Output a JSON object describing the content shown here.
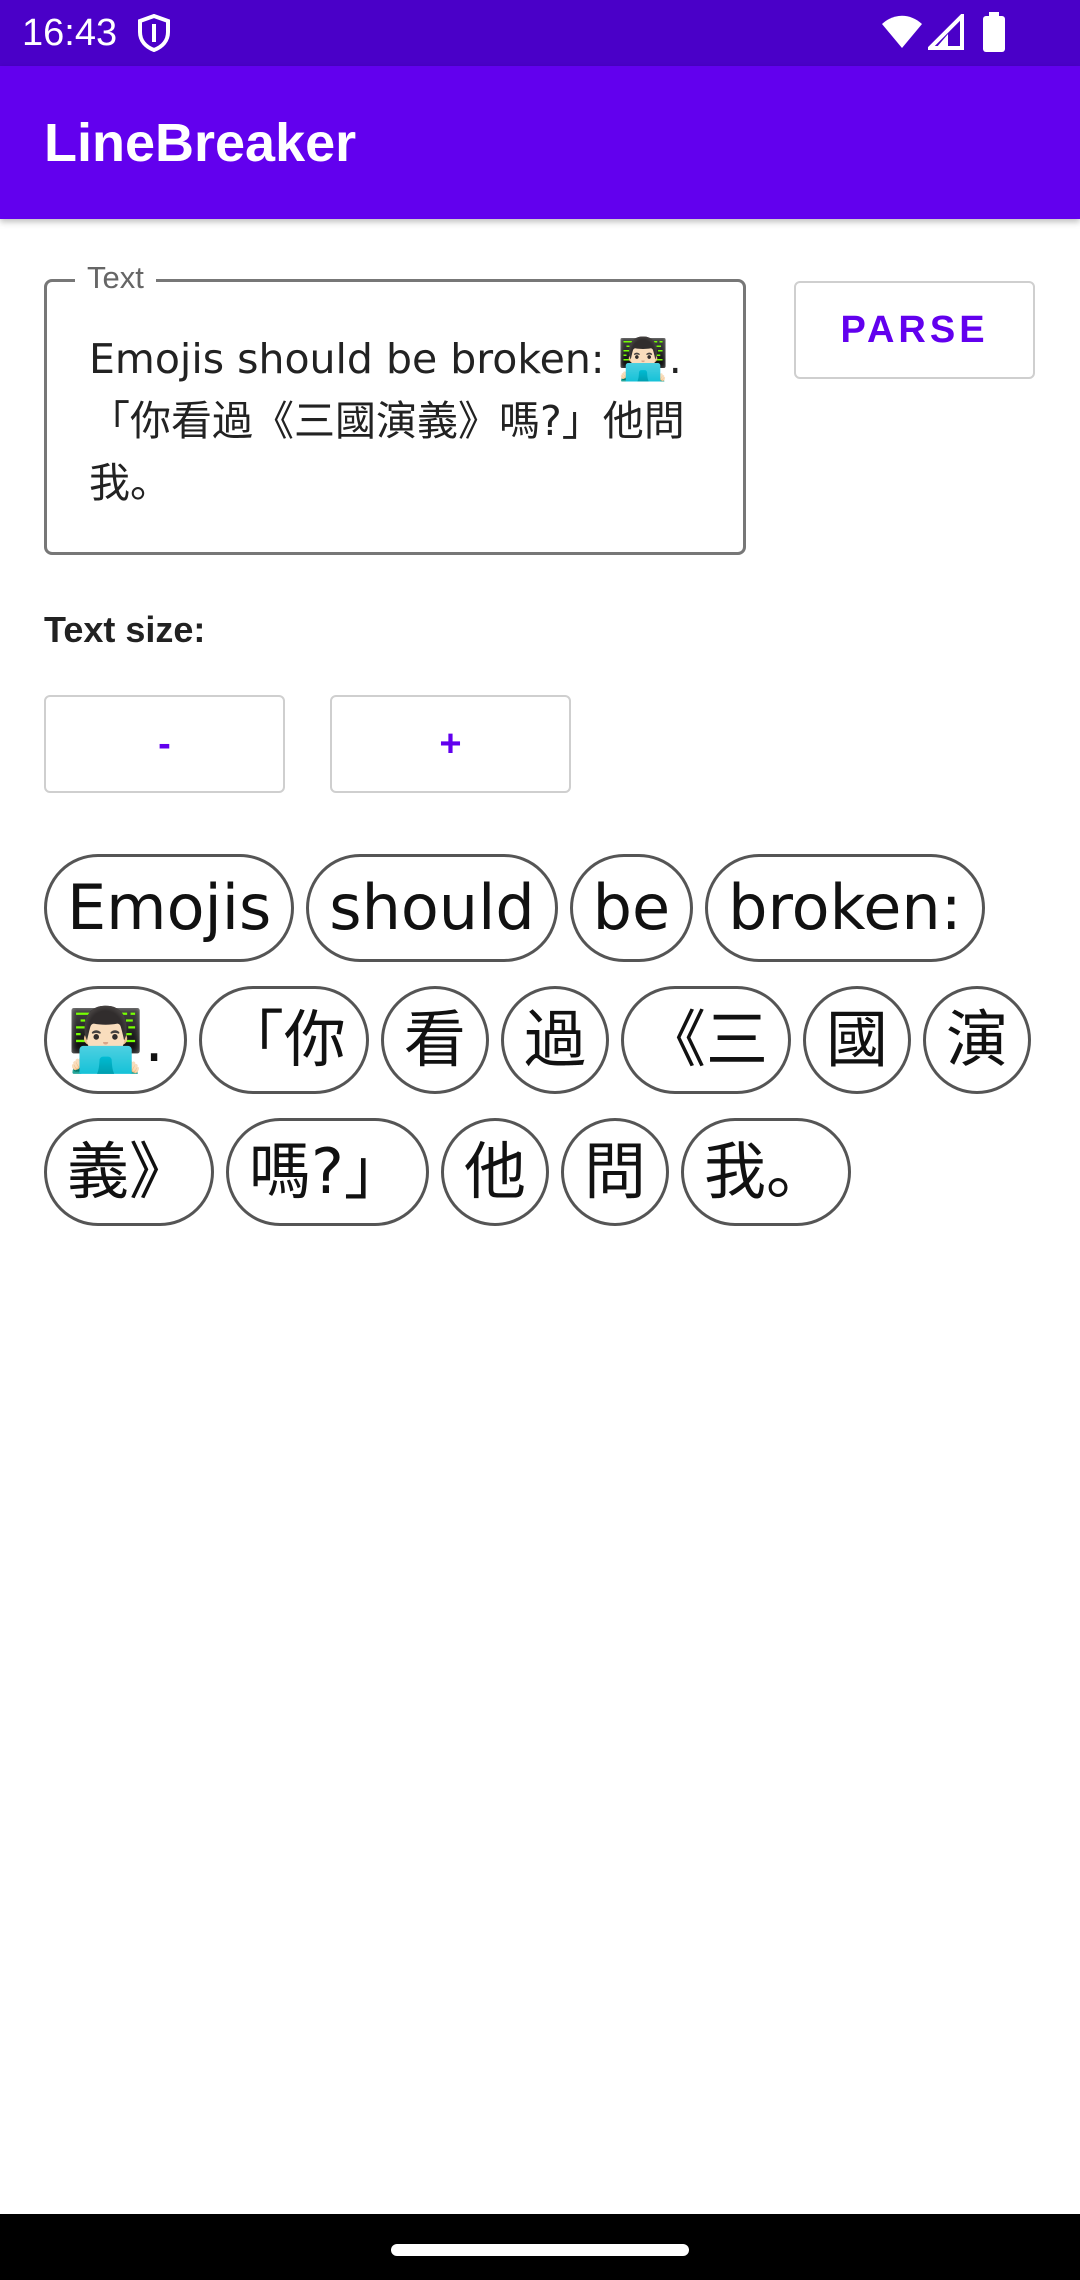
{
  "status_bar": {
    "time": "16:43",
    "icons": [
      "shield-icon",
      "wifi-icon",
      "signal-icon",
      "battery-icon"
    ]
  },
  "app_bar": {
    "title": "LineBreaker",
    "color": "#6200ee"
  },
  "text_field": {
    "label": "Text",
    "value": "Emojis should be broken: 👨🏻‍💻. 「你看過《三國演義》嗎?」他問我。"
  },
  "parse_button": {
    "label": "PARSE"
  },
  "text_size": {
    "label": "Text size:",
    "decrease_label": "-",
    "increase_label": "+"
  },
  "chips": [
    "Emojis ",
    "should ",
    "be ",
    "broken: ",
    "👨🏻‍💻. ",
    "「你",
    "看",
    "過",
    "《三",
    "國",
    "演",
    "義》",
    "嗎?」",
    "他",
    "問",
    "我。"
  ],
  "colors": {
    "status_bar": "#4a00c8",
    "accent": "#6200ee"
  }
}
